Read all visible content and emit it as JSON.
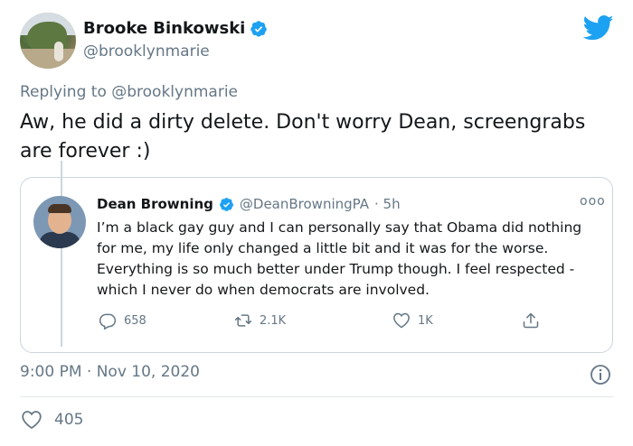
{
  "tweet": {
    "author": {
      "name": "Brooke Binkowski",
      "handle": "@brooklynmarie",
      "verified": true
    },
    "replying_to": "Replying to @brooklynmarie",
    "text": "Aw, he did a dirty delete. Don't worry Dean, screengrabs are forever :)",
    "timestamp": "9:00 PM · Nov 10, 2020",
    "likes": "405"
  },
  "quoted": {
    "name": "Dean Browning",
    "handle": "@DeanBrowningPA",
    "time": "· 5h",
    "text": "I’m a black gay guy and I can personally say that Obama did nothing for me, my life only changed a little bit and it was for the worse. Everything is so much better under Trump though. I feel respected - which I never do when democrats are involved.",
    "more": "ooo",
    "replies": "658",
    "retweets": "2.1K",
    "likes": "1K"
  },
  "colors": {
    "twitter_blue": "#1da1f2",
    "secondary_text": "#657786",
    "border": "#ccd6dd"
  },
  "icons": [
    "verified-badge-icon",
    "twitter-bird-icon",
    "reply-icon",
    "retweet-icon",
    "heart-icon",
    "share-icon",
    "info-icon"
  ]
}
